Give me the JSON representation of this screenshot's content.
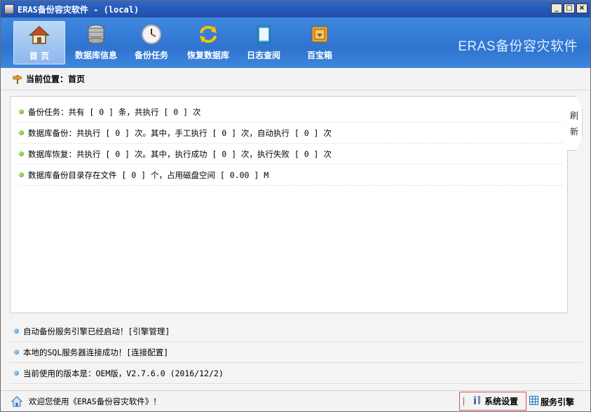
{
  "window": {
    "title": "ERAS备份容灾软件 - (local)",
    "controls": {
      "minimize": "_",
      "maximize": "□",
      "close": "×"
    }
  },
  "toolbar": {
    "items": [
      {
        "label": "首 页",
        "icon": "home-icon",
        "active": true
      },
      {
        "label": "数据库信息",
        "icon": "database-icon"
      },
      {
        "label": "备份任务",
        "icon": "clock-icon"
      },
      {
        "label": "恢复数据库",
        "icon": "refresh-arrows-icon"
      },
      {
        "label": "日志查阅",
        "icon": "book-icon"
      },
      {
        "label": "百宝箱",
        "icon": "toolbox-icon"
      }
    ],
    "brand": "ERAS备份容灾软件"
  },
  "breadcrumb": {
    "text": "当前位置：首页"
  },
  "stats": {
    "rows": [
      "备份任务：共有 [ 0 ] 条，共执行 [ 0 ] 次",
      "数据库备份：共执行 [ 0 ] 次。其中，手工执行 [ 0 ] 次，自动执行 [ 0 ] 次",
      "数据库恢复：共执行 [ 0 ] 次。其中，执行成功 [ 0 ] 次，执行失败 [ 0 ] 次",
      "数据库备份目录存在文件 [ 0 ] 个，占用磁盘空间 [ 0.00 ] M"
    ],
    "refresh_label_1": "刷",
    "refresh_label_2": "新"
  },
  "info": {
    "rows": [
      "自动备份服务引擎已经启动！[引擎管理]",
      "本地的SQL服务器连接成功！[连接配置]",
      "当前使用的版本是：OEM版，V2.7.6.0 (2016/12/2)"
    ]
  },
  "statusbar": {
    "welcome": "欢迎您使用《ERAS备份容灾软件》！",
    "settings_label": "系统设置",
    "engine_label": "服务引擎"
  },
  "colors": {
    "toolbar_blue": "#2f74cf",
    "titlebar_blue": "#1f4fa8",
    "status_green": "#4ca318",
    "info_blue": "#2f86c9",
    "settings_border": "#d9534f"
  }
}
